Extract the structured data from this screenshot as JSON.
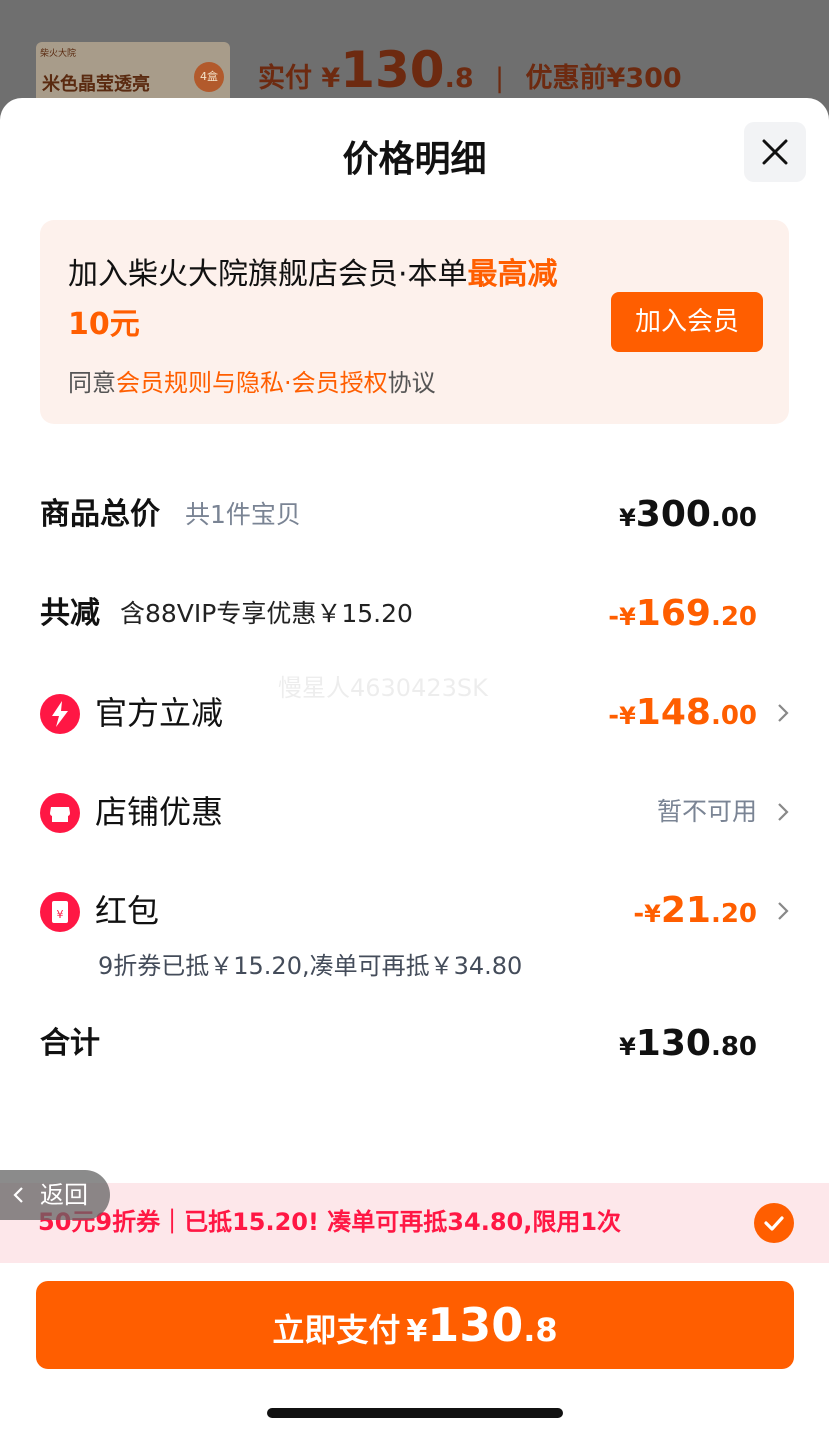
{
  "background": {
    "thumb_lines": [
      "柴火大院",
      "米色晶莹透亮"
    ],
    "thumb_badge": "4盒",
    "paid_label": "实付",
    "paid_currency": "¥",
    "paid_int": "130",
    "paid_dec": ".8",
    "separator": "|",
    "before_label": "优惠前",
    "before_amount": "¥300"
  },
  "sheet": {
    "title": "价格明细"
  },
  "member": {
    "headline_plain": "加入柴火大院旗舰店会员·本单",
    "headline_highlight": "最高减10元",
    "join_label": "加入会员",
    "agree_prefix": "同意",
    "agree_link": "会员规则与隐私·会员授权",
    "agree_suffix": "协议"
  },
  "rows": {
    "total": {
      "label": "商品总价",
      "sub": "共1件宝贝",
      "currency": "¥",
      "int": "300",
      "dec": ".00"
    },
    "reduce": {
      "label": "共减",
      "sub": "含88VIP专享优惠￥15.20",
      "prefix": "-",
      "currency": "¥",
      "int": "169",
      "dec": ".20"
    },
    "official": {
      "label": "官方立减",
      "prefix": "-",
      "currency": "¥",
      "int": "148",
      "dec": ".00"
    },
    "shop": {
      "label": "店铺优惠",
      "status": "暂不可用"
    },
    "redpacket": {
      "label": "红包",
      "icon_char": "¥",
      "prefix": "-",
      "currency": "¥",
      "int": "21",
      "dec": ".20",
      "note": "9折券已抵￥15.20,凑单可再抵￥34.80"
    },
    "sum": {
      "label": "合计",
      "currency": "¥",
      "int": "130",
      "dec": ".80"
    }
  },
  "watermark": "慢星人4630423SK",
  "coupon": {
    "text": "50元9折券｜已抵15.20! 凑单可再抵34.80,限用1次"
  },
  "back": {
    "label": "返回"
  },
  "pay": {
    "label": "立即支付",
    "currency": "¥",
    "int": "130",
    "dec": ".8"
  },
  "colors": {
    "accent": "#ff5e00",
    "red": "#ff1744",
    "banner_bg": "#fdf1ec",
    "coupon_bg": "#fde7ea"
  }
}
